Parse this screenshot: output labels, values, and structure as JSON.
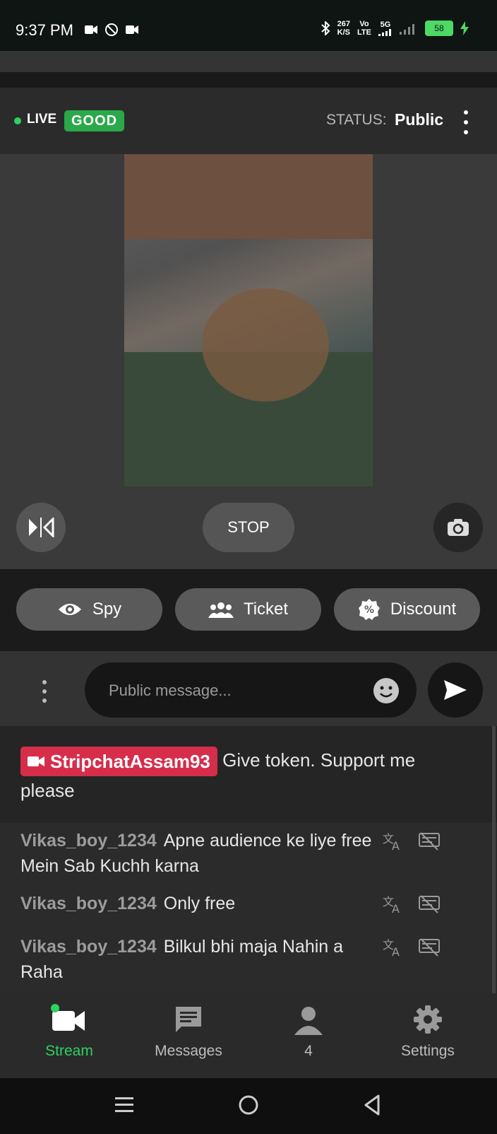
{
  "statusbar": {
    "time": "9:37 PM",
    "speed_value": "267",
    "speed_unit": "K/S",
    "volte_top": "Vo",
    "volte_bottom": "LTE",
    "network": "5G",
    "battery": "58"
  },
  "header": {
    "live_label": "LIVE",
    "quality_badge": "GOOD",
    "status_label": "STATUS:",
    "status_value": "Public"
  },
  "controls": {
    "stop_label": "STOP"
  },
  "actions": [
    {
      "label": "Spy",
      "icon": "eye-icon"
    },
    {
      "label": "Ticket",
      "icon": "group-icon"
    },
    {
      "label": "Discount",
      "icon": "percent-icon"
    }
  ],
  "composer": {
    "placeholder": "Public message..."
  },
  "chat": {
    "notice": {
      "username": "StripchatAssam93",
      "text": "Give token. Support me please"
    },
    "messages": [
      {
        "username": "Vikas_boy_1234",
        "text": "Apne audience ke liye free Mein Sab Kuchh karna"
      },
      {
        "username": "Vikas_boy_1234",
        "text": "Only free"
      },
      {
        "username": "Vikas_boy_1234",
        "text": "Bilkul bhi maja Nahin a Raha"
      }
    ]
  },
  "tabs": [
    {
      "label": "Stream",
      "active": true
    },
    {
      "label": "Messages",
      "active": false
    },
    {
      "label": "4",
      "active": false
    },
    {
      "label": "Settings",
      "active": false
    }
  ],
  "colors": {
    "accent_green": "#2fd15f",
    "badge_good": "#2aa84a",
    "broadcaster_tag": "#d62d4a"
  }
}
